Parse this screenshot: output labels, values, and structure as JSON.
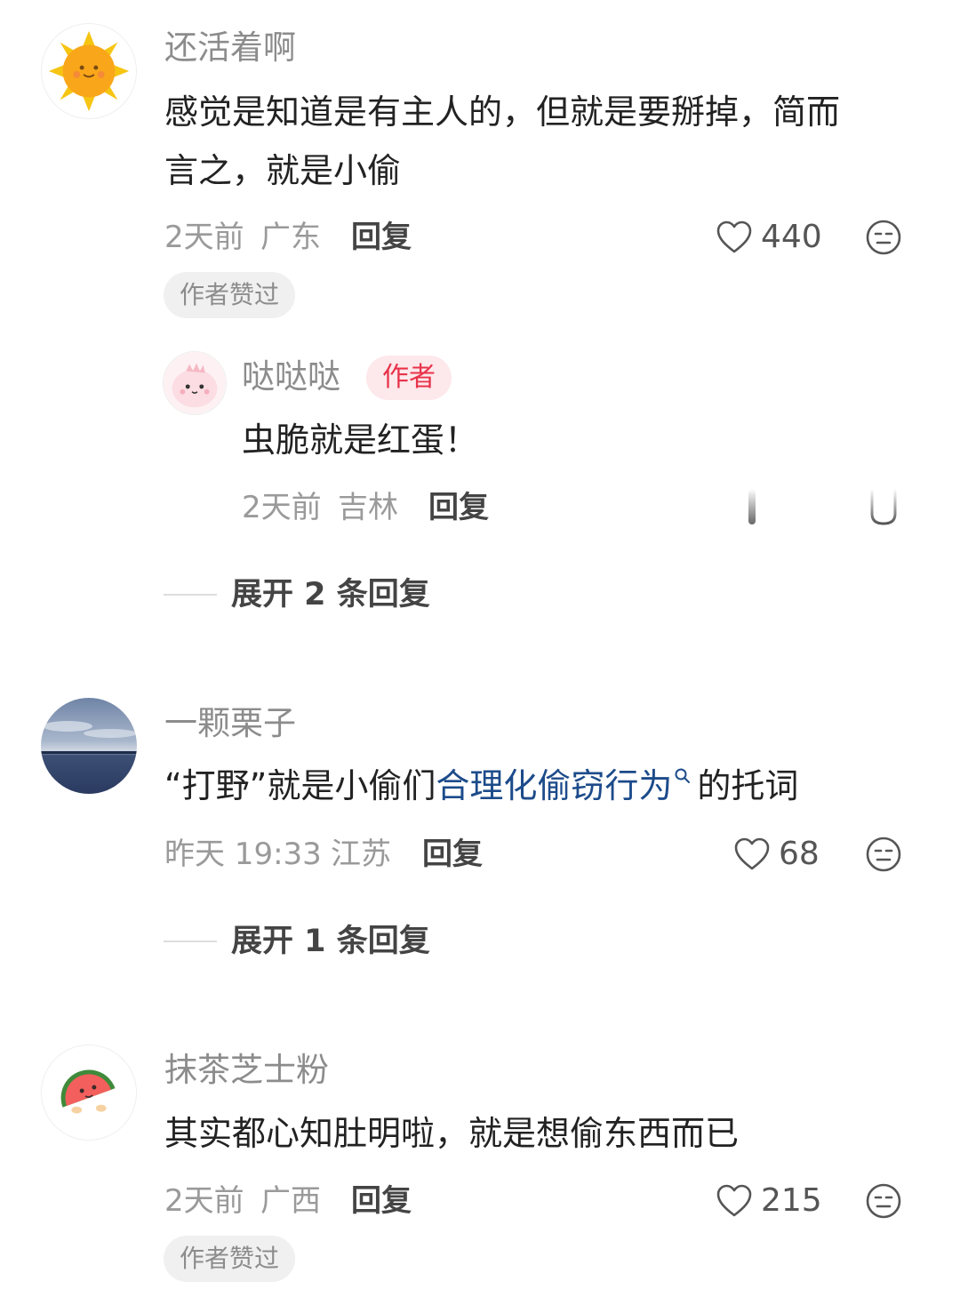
{
  "comments": [
    {
      "username": "还活着啊",
      "text_line1": "感觉是知道是有主人的，但就是要掰掉，简而",
      "text_line2": "言之，就是小偷",
      "time": "2天前",
      "location": "广东",
      "reply_label": "回复",
      "likes": "440",
      "author_liked": "作者赞过",
      "avatar_icon": "sun-face-icon",
      "replies": [
        {
          "username": "哒哒哒",
          "badge": "作者",
          "text": "虫脆就是红蛋！",
          "time": "2天前",
          "location": "吉林",
          "reply_label": "回复",
          "avatar_icon": "pink-dinosaur-icon"
        }
      ],
      "expand_label": "展开 2 条回复"
    },
    {
      "username": "一颗栗子",
      "text_prefix": "“打野”就是小偷们",
      "text_link": "合理化偷窃行为",
      "text_suffix": "的托词",
      "time": "昨天 19:33",
      "location": "江苏",
      "reply_label": "回复",
      "likes": "68",
      "avatar_icon": "sea-landscape-icon",
      "expand_label": "展开 1 条回复"
    },
    {
      "username": "抹茶芝士粉",
      "text": "其实都心知肚明啦，就是想偷东西而已",
      "time": "2天前",
      "location": "广西",
      "reply_label": "回复",
      "likes": "215",
      "author_liked": "作者赞过",
      "avatar_icon": "watermelon-icon"
    }
  ],
  "colors": {
    "link": "#1c4b8a",
    "author_badge_bg": "#fde8eb",
    "author_badge_text": "#e8334a",
    "tag_bg": "#f0f0f0"
  }
}
